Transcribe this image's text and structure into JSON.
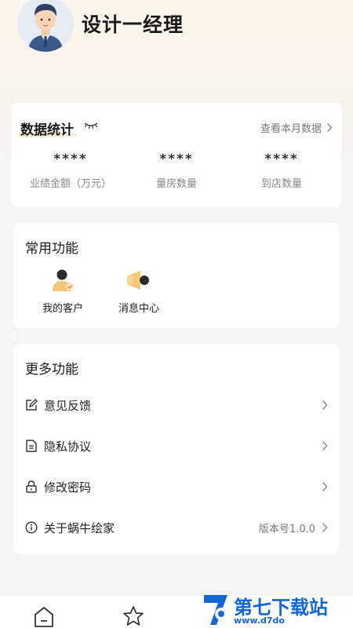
{
  "header": {
    "username": "设计一经理"
  },
  "stats": {
    "title": "数据统计",
    "month_link": "查看本月数据",
    "items": [
      {
        "value": "****",
        "label": "业绩金额（万元）"
      },
      {
        "value": "****",
        "label": "量房数量"
      },
      {
        "value": "****",
        "label": "到店数量"
      }
    ]
  },
  "common": {
    "title": "常用功能",
    "items": [
      {
        "label": "我的客户",
        "icon": "customer-icon"
      },
      {
        "label": "消息中心",
        "icon": "megaphone-icon"
      }
    ]
  },
  "more": {
    "title": "更多功能",
    "rows": [
      {
        "label": "意见反馈",
        "value": "",
        "icon": "edit-icon"
      },
      {
        "label": "隐私协议",
        "value": "",
        "icon": "document-icon"
      },
      {
        "label": "修改密码",
        "value": "",
        "icon": "lock-icon"
      },
      {
        "label": "关于蜗牛绘家",
        "value": "版本号1.0.0",
        "icon": "info-icon"
      }
    ]
  },
  "watermark": {
    "title": "第七下载站",
    "url": "www.d7do"
  },
  "colors": {
    "accent": "#f6b74a",
    "watermark": "#1266d8"
  }
}
